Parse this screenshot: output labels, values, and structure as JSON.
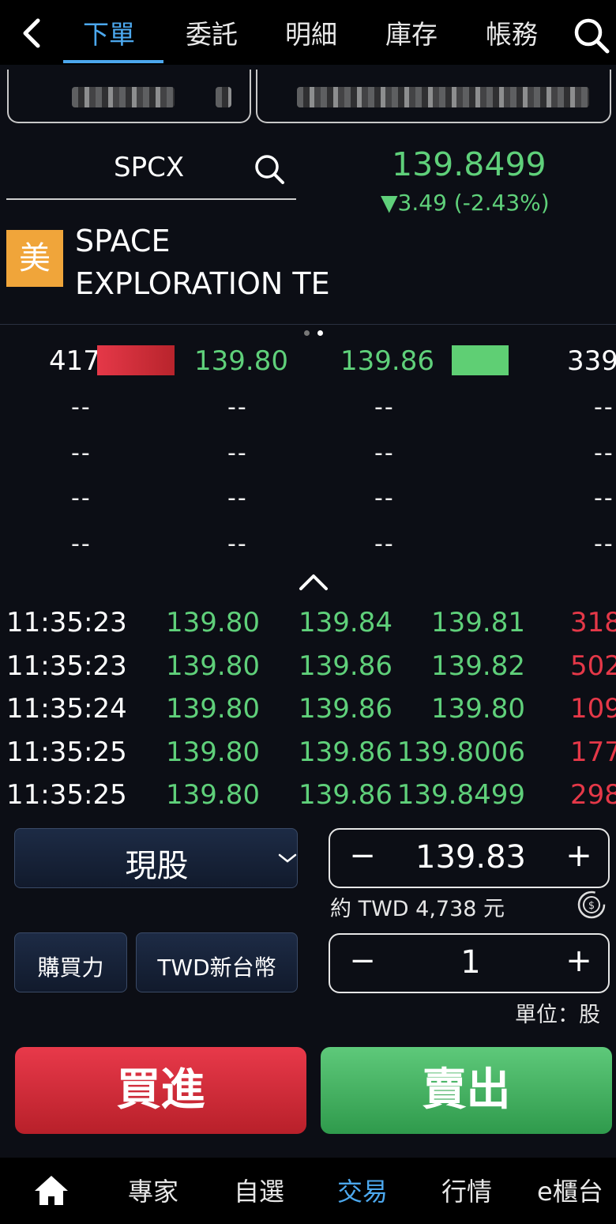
{
  "nav": {
    "tabs": [
      "下單",
      "委託",
      "明細",
      "庫存",
      "帳務"
    ],
    "active_tab": "下單"
  },
  "quote": {
    "symbol": "SPCX",
    "last_price": "139.8499",
    "change": "▼3.49 (-2.43%)",
    "market_badge": "美",
    "name_line1": "SPACE",
    "name_line2": "EXPLORATION TE"
  },
  "order_book": {
    "bid_qty": "417",
    "bid_price": "139.80",
    "ask_price": "139.86",
    "ask_qty": "339",
    "empty": "--"
  },
  "trades": [
    {
      "time": "11:35:23",
      "bid": "139.80",
      "ask": "139.84",
      "price": "139.81",
      "vol": "318"
    },
    {
      "time": "11:35:23",
      "bid": "139.80",
      "ask": "139.86",
      "price": "139.82",
      "vol": "502"
    },
    {
      "time": "11:35:24",
      "bid": "139.80",
      "ask": "139.86",
      "price": "139.80",
      "vol": "109"
    },
    {
      "time": "11:35:25",
      "bid": "139.80",
      "ask": "139.86",
      "price": "139.8006",
      "vol": "177"
    },
    {
      "time": "11:35:25",
      "bid": "139.80",
      "ask": "139.86",
      "price": "139.8499",
      "vol": "298"
    }
  ],
  "order": {
    "type": "現股",
    "price": "139.83",
    "approx": "約 TWD 4,738 元",
    "buying_power": "購買力",
    "currency": "TWD新台幣",
    "qty": "1",
    "unit": "單位：股",
    "buy": "買進",
    "sell": "賣出",
    "minus": "−",
    "plus": "+"
  },
  "bottom_nav": {
    "items": [
      "專家",
      "自選",
      "交易",
      "行情",
      "e櫃台"
    ],
    "active": "交易"
  },
  "colors": {
    "up_red": "#e53848",
    "down_green": "#5fd07a",
    "accent_blue": "#4ca8ee",
    "badge_orange": "#f0a53a"
  }
}
